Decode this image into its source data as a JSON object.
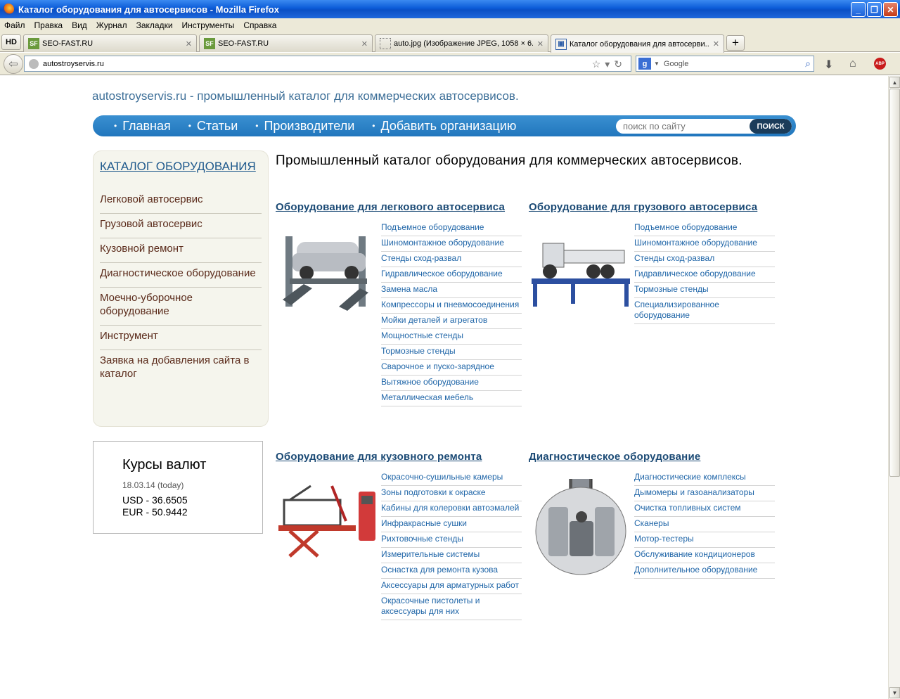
{
  "browser": {
    "window_title": "Каталог оборудования для автосервисов - Mozilla Firefox",
    "menu": [
      "Файл",
      "Правка",
      "Вид",
      "Журнал",
      "Закладки",
      "Инструменты",
      "Справка"
    ],
    "hd_label": "HD",
    "tabs": [
      {
        "label": "SEO-FAST.RU",
        "icon": "SF"
      },
      {
        "label": "SEO-FAST.RU",
        "icon": "SF"
      },
      {
        "label": "auto.jpg (Изображение JPEG, 1058 × 6...",
        "icon": ""
      },
      {
        "label": "Каталог оборудования для автосерви...",
        "icon": ""
      }
    ],
    "url": "autostroyservis.ru",
    "search_engine": "Google",
    "adblock_label": "ABP"
  },
  "site": {
    "title": "autostroyservis.ru - промышленный каталог для коммерческих автосервисов.",
    "nav": [
      "Главная",
      "Статьи",
      "Производители",
      "Добавить организацию"
    ],
    "search_placeholder": "поиск по сайту",
    "search_button": "ПОИСК"
  },
  "sidebar": {
    "title": "КАТАЛОГ ОБОРУДОВАНИЯ",
    "items": [
      "Легковой автосервис",
      "Грузовой автосервис",
      "Кузовной ремонт",
      "Диагностическое оборудование",
      "Моечно-уборочное оборудование",
      "Инструмент",
      "Заявка на добавления сайта в каталог"
    ]
  },
  "rates": {
    "title": "Курсы валют",
    "date": "18.03.14 (today)",
    "usd": "USD - 36.6505",
    "eur": "EUR - 50.9442"
  },
  "main": {
    "heading": "Промышленный каталог оборудования для коммерческих автосервисов.",
    "categories": [
      {
        "title": "Оборудование для легкового автосервиса",
        "links": [
          "Подъемное оборудование",
          "Шиномонтажное оборудование",
          "Стенды сход-развал",
          "Гидравлическое оборудование",
          "Замена масла",
          "Компрессоры и пневмосоединения",
          "Мойки деталей и агрегатов",
          "Мощностные стенды",
          "Тормозные стенды",
          "Сварочное и пуско-зарядное",
          "Вытяжное оборудование",
          "Металлическая мебель"
        ]
      },
      {
        "title": "Оборудование для грузового автосервиса",
        "links": [
          "Подъемное оборудование",
          "Шиномонтажное оборудование",
          "Стенды сход-развал",
          "Гидравлическое оборудование",
          "Тормозные стенды",
          "Специализированное оборудование"
        ]
      },
      {
        "title": "Оборудование для кузовного ремонта",
        "links": [
          "Окрасочно-сушильные камеры",
          "Зоны подготовки к окраске",
          "Кабины для колеровки автоэмалей",
          "Инфракрасные сушки",
          "Рихтовочные стенды",
          "Измерительные системы",
          "Оснастка для ремонта кузова",
          "Аксессуары для арматурных работ",
          "Окрасочные пистолеты и аксессуары для них"
        ]
      },
      {
        "title": "Диагностическое оборудование",
        "links": [
          "Диагностические комплексы",
          "Дымомеры и газоанализаторы",
          "Очистка топливных систем",
          "Сканеры",
          "Мотор-тестеры",
          "Обслуживание кондиционеров",
          "Дополнительное оборудование"
        ]
      }
    ]
  }
}
